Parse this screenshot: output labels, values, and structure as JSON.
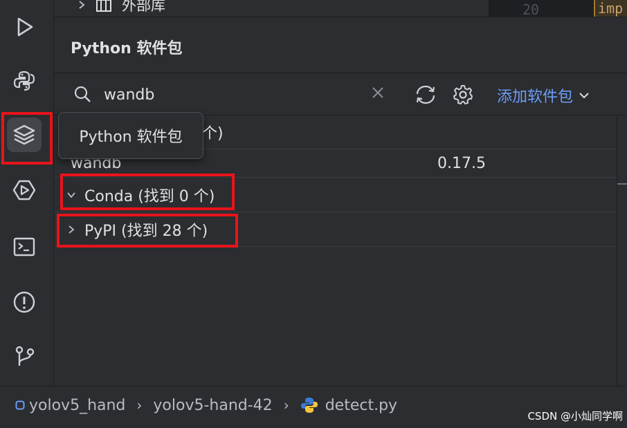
{
  "top": {
    "ext_lib_label": "外部库",
    "gutter_line": "20",
    "code_fragment": "imp"
  },
  "panel": {
    "title": "Python 软件包"
  },
  "search": {
    "value": "wandb",
    "add_package_label": "添加软件包"
  },
  "tooltip": {
    "text": "Python 软件包"
  },
  "list": {
    "installed_suffix": "个)",
    "package": {
      "name": "wandb",
      "version": "0.17.5"
    },
    "conda_label": "Conda (找到 0 个)",
    "pypi_label": "PyPI (找到 28 个)"
  },
  "breadcrumb": {
    "items": [
      "yolov5_hand",
      "yolov5-hand-42",
      "detect.py"
    ]
  },
  "watermark": "CSDN @小灿同学啊",
  "icons": {
    "strip": [
      "run-icon",
      "python-console-icon",
      "python-packages-icon",
      "services-icon",
      "terminal-icon",
      "problems-icon",
      "git-icon"
    ]
  },
  "colors": {
    "background": "#2b2d30",
    "accent_link": "#6c9df8",
    "highlight_box": "#e8141a"
  }
}
